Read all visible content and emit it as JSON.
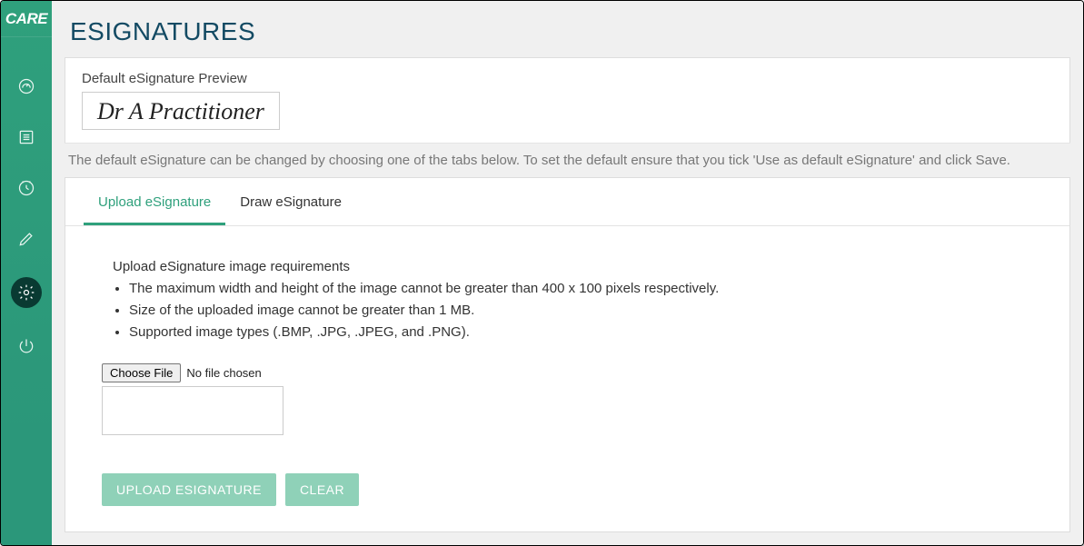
{
  "logo": "CARE",
  "sidebar": {
    "icons": [
      {
        "name": "dashboard-icon"
      },
      {
        "name": "list-icon"
      },
      {
        "name": "clock-icon"
      },
      {
        "name": "pencil-icon"
      },
      {
        "name": "gear-icon",
        "active": true
      },
      {
        "name": "power-icon"
      }
    ]
  },
  "page": {
    "title": "ESIGNATURES",
    "preview_label": "Default eSignature Preview",
    "signature_text": "Dr A Practitioner",
    "help_text": "The default eSignature can be changed by choosing one of the tabs below. To set the default ensure that you tick 'Use as default eSignature' and click Save."
  },
  "tabs": [
    {
      "label": "Upload eSignature",
      "active": true
    },
    {
      "label": "Draw eSignature",
      "active": false
    }
  ],
  "upload": {
    "requirements_heading": "Upload eSignature image requirements",
    "requirements": [
      "The maximum width and height of the image cannot be greater than 400 x 100 pixels respectively.",
      "Size of the uploaded image cannot be greater than 1 MB.",
      "Supported image types (.BMP, .JPG, .JPEG, and .PNG)."
    ],
    "choose_file_label": "Choose File",
    "file_status": "No file chosen",
    "upload_button": "UPLOAD ESIGNATURE",
    "clear_button": "CLEAR"
  }
}
